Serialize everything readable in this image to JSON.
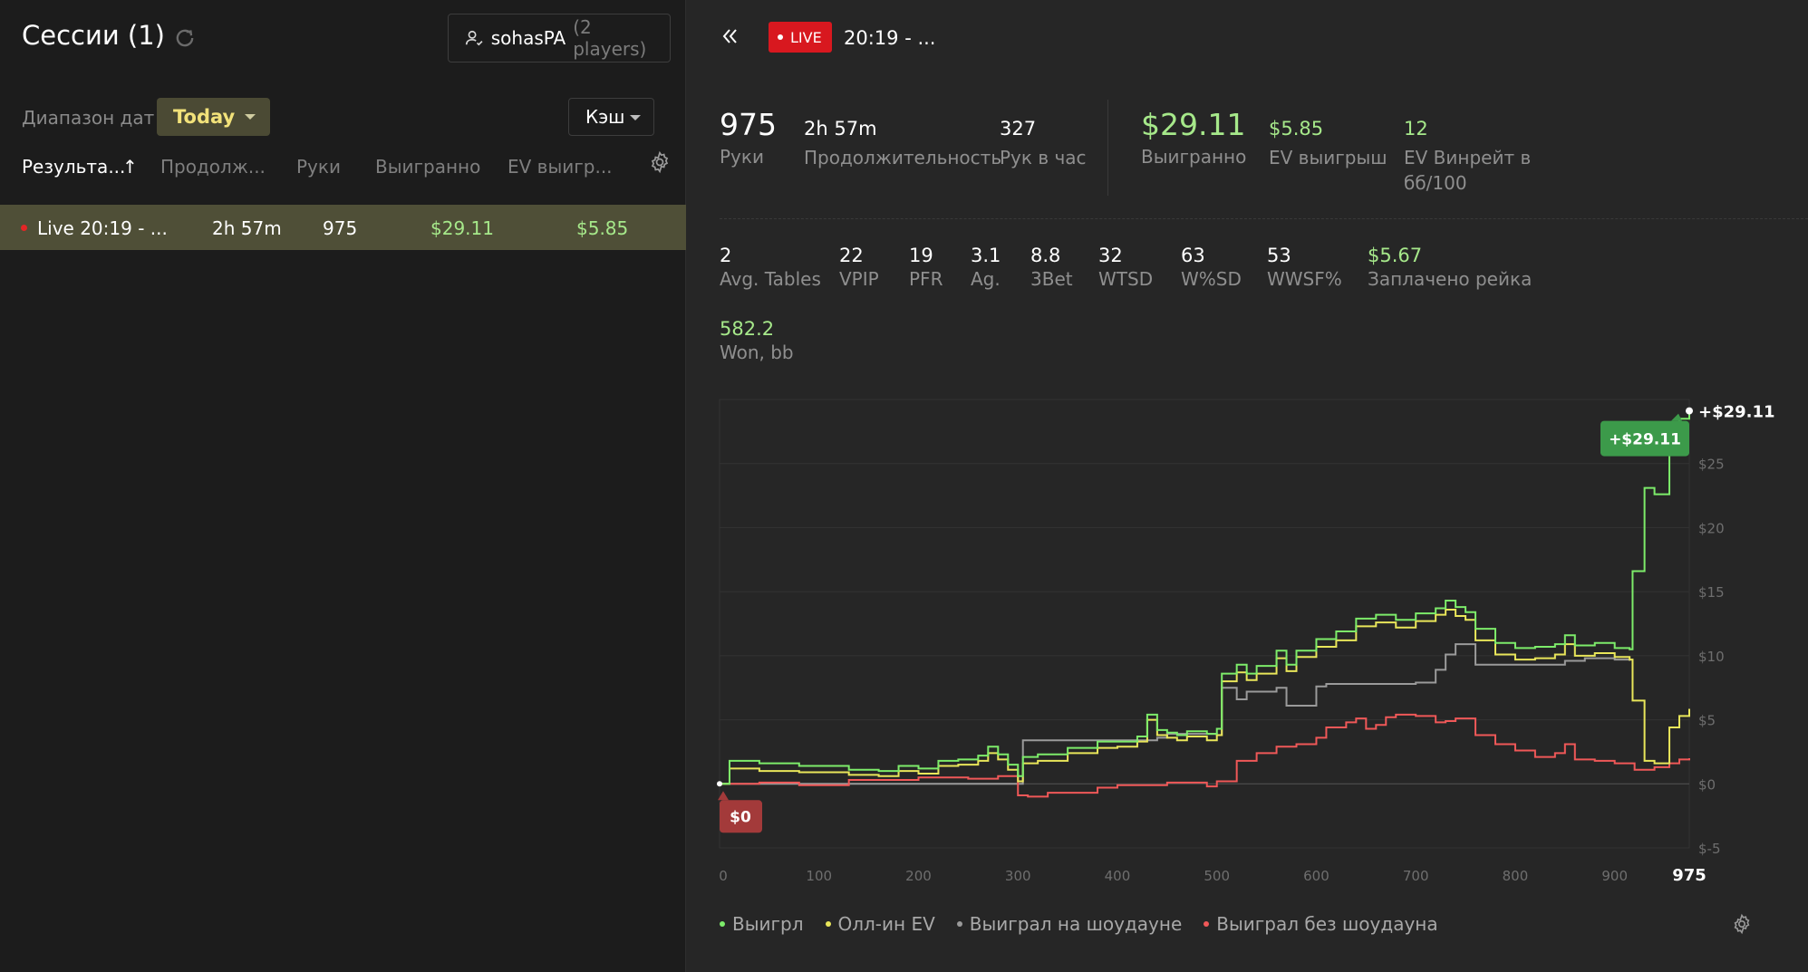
{
  "left": {
    "title": "Сессии (1)",
    "refresh_icon": "refresh-icon",
    "player": {
      "name": "sohasPA",
      "count": "(2 players)"
    },
    "range_label": "Диапазон дат",
    "range_value": "Today",
    "game_type": "Кэш",
    "columns": [
      "Результа...",
      "Продолж...",
      "Руки",
      "Выигранно",
      "EV выигр..."
    ],
    "sort_arrow": "↑",
    "row": {
      "name": "Live 20:19 - ...",
      "duration": "2h 57m",
      "hands": "975",
      "won": "$29.11",
      "ev": "$5.85"
    }
  },
  "right": {
    "live_label": "LIVE",
    "session_name": "20:19 - ...",
    "stats": {
      "hands": {
        "value": "975",
        "label": "Руки"
      },
      "duration": {
        "value": "2h 57m",
        "label": "Продолжительность"
      },
      "hands_per_hour": {
        "value": "327",
        "label": "Рук в час"
      },
      "won": {
        "value": "$29.11",
        "label": "Выигранно"
      },
      "ev_won": {
        "value": "$5.85",
        "label": "EV выигрыш"
      },
      "ev_winrate": {
        "value": "12",
        "label1": "EV Винрейт в",
        "label2": "бб/100"
      }
    },
    "stats2": {
      "tables": {
        "value": "2",
        "label": "Avg. Tables"
      },
      "vpip": {
        "value": "22",
        "label": "VPIP"
      },
      "pfr": {
        "value": "19",
        "label": "PFR"
      },
      "ag": {
        "value": "3.1",
        "label": "Ag."
      },
      "threebet": {
        "value": "8.8",
        "label": "3Bet"
      },
      "wtsd": {
        "value": "32",
        "label": "WTSD"
      },
      "wsd": {
        "value": "63",
        "label": "W%SD"
      },
      "wwsf": {
        "value": "53",
        "label": "WWSF%"
      },
      "rake": {
        "value": "$5.67",
        "label": "Заплачено рейка"
      },
      "won_bb": {
        "value": "582.2",
        "label": "Won, bb"
      }
    },
    "legend": [
      {
        "label": "Выигрл",
        "color": "#7dec6a"
      },
      {
        "label": "Олл-ин EV",
        "color": "#e9e65a"
      },
      {
        "label": "Выиграл на шоудауне",
        "color": "#9a9a9a"
      },
      {
        "label": "Выиграл без шоудауна",
        "color": "#f05858"
      }
    ]
  },
  "chart_data": {
    "type": "line",
    "xlim": [
      0,
      975
    ],
    "ylim": [
      -5,
      30
    ],
    "x_ticks": [
      0,
      100,
      200,
      300,
      400,
      500,
      600,
      700,
      800,
      900,
      975
    ],
    "y_ticks": [
      -5,
      0,
      5,
      10,
      15,
      20,
      25
    ],
    "y_tick_labels": [
      "$-5",
      "$0",
      "$5",
      "$10",
      "$15",
      "$20",
      "$25"
    ],
    "end_label": "+$29.11",
    "end_badge": "+$29.11",
    "start_badge": "$0",
    "grid": true,
    "series": [
      {
        "name": "Выигрл",
        "color": "#7dec6a",
        "x": [
          0,
          10,
          40,
          80,
          130,
          160,
          180,
          200,
          220,
          240,
          260,
          270,
          280,
          290,
          300,
          305,
          320,
          350,
          380,
          400,
          420,
          430,
          440,
          450,
          460,
          470,
          490,
          500,
          505,
          520,
          530,
          540,
          560,
          570,
          580,
          600,
          620,
          640,
          660,
          680,
          700,
          720,
          730,
          740,
          750,
          760,
          780,
          800,
          820,
          840,
          850,
          860,
          880,
          900,
          915,
          918,
          930,
          940,
          955,
          965,
          975
        ],
        "y": [
          0,
          1.8,
          1.6,
          1.4,
          1.1,
          1.0,
          1.4,
          1.2,
          1.8,
          1.9,
          2.2,
          2.9,
          2.3,
          1.5,
          0.6,
          2.1,
          2.3,
          2.8,
          3.3,
          3.3,
          3.7,
          5.4,
          4.2,
          4.0,
          3.8,
          4.1,
          3.9,
          4.3,
          8.6,
          9.3,
          8.6,
          9.2,
          10.4,
          9.3,
          10.4,
          11.3,
          11.9,
          12.9,
          13.2,
          12.8,
          13.3,
          13.7,
          14.3,
          13.8,
          13.4,
          12.1,
          11.0,
          10.6,
          10.7,
          10.9,
          11.6,
          10.8,
          11.0,
          10.6,
          10.5,
          16.6,
          23.1,
          22.6,
          27.0,
          28.5,
          29.11
        ]
      },
      {
        "name": "Олл-ин EV",
        "color": "#e9e65a",
        "x": [
          0,
          10,
          40,
          80,
          130,
          160,
          180,
          200,
          220,
          240,
          260,
          270,
          280,
          290,
          300,
          305,
          320,
          350,
          380,
          400,
          420,
          430,
          440,
          450,
          460,
          470,
          490,
          500,
          505,
          520,
          530,
          540,
          560,
          570,
          580,
          600,
          620,
          640,
          660,
          680,
          700,
          720,
          730,
          740,
          750,
          760,
          780,
          800,
          820,
          840,
          850,
          860,
          880,
          900,
          915,
          918,
          930,
          940,
          955,
          965,
          975
        ],
        "y": [
          0,
          1.2,
          1.0,
          0.9,
          0.7,
          0.6,
          1.0,
          0.8,
          1.4,
          1.5,
          1.8,
          2.4,
          1.9,
          1.1,
          0.2,
          1.6,
          1.8,
          2.4,
          2.8,
          2.9,
          3.3,
          5.0,
          3.8,
          3.6,
          3.4,
          3.7,
          3.4,
          3.8,
          8.0,
          8.7,
          8.1,
          8.6,
          9.8,
          8.8,
          9.9,
          10.7,
          11.2,
          12.3,
          12.6,
          12.2,
          12.7,
          13.2,
          13.6,
          13.1,
          12.8,
          11.2,
          10.1,
          9.7,
          9.8,
          10.1,
          10.9,
          10.0,
          10.2,
          9.9,
          9.7,
          6.5,
          1.8,
          1.6,
          4.4,
          5.3,
          5.85
        ]
      },
      {
        "name": "Выиграл на шоудауне",
        "color": "#9a9a9a",
        "x": [
          0,
          300,
          305,
          440,
          450,
          500,
          505,
          520,
          530,
          560,
          570,
          600,
          610,
          700,
          720,
          730,
          740,
          760,
          790,
          810,
          830,
          850,
          870,
          900,
          915
        ],
        "y": [
          0,
          0,
          3.4,
          3.6,
          3.9,
          3.8,
          7.5,
          6.6,
          7.2,
          7.5,
          6.1,
          7.6,
          7.8,
          7.9,
          8.9,
          10.1,
          10.9,
          9.3,
          9.3,
          9.3,
          9.3,
          9.6,
          9.8,
          9.7,
          9.6
        ]
      },
      {
        "name": "Выиграл без шоудауна",
        "color": "#f05858",
        "x": [
          0,
          40,
          80,
          130,
          200,
          250,
          280,
          300,
          310,
          330,
          380,
          400,
          450,
          490,
          500,
          520,
          540,
          560,
          580,
          600,
          610,
          630,
          640,
          650,
          660,
          670,
          680,
          700,
          720,
          730,
          740,
          760,
          780,
          800,
          820,
          840,
          850,
          860,
          880,
          900,
          920,
          940,
          955,
          965,
          975
        ],
        "y": [
          0,
          0.1,
          -0.1,
          0.3,
          0.5,
          0.4,
          0.6,
          -0.9,
          -1.0,
          -0.7,
          -0.3,
          -0.1,
          0.1,
          -0.2,
          0.2,
          1.8,
          2.4,
          2.9,
          3.1,
          3.6,
          4.4,
          4.8,
          5.1,
          4.3,
          4.6,
          5.2,
          5.4,
          5.3,
          4.8,
          4.9,
          5.1,
          3.8,
          3.1,
          2.6,
          2.1,
          2.4,
          3.1,
          1.9,
          1.8,
          1.6,
          1.1,
          1.3,
          1.6,
          1.9,
          2.0
        ]
      }
    ]
  }
}
